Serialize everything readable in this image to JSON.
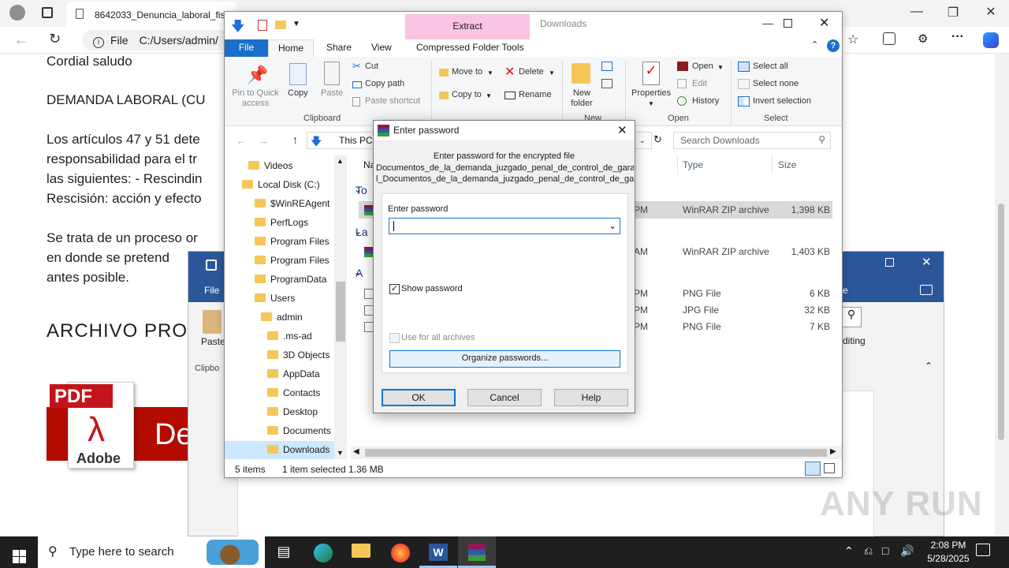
{
  "browser": {
    "tab_title": "8642033_Denuncia_laboral_fisc",
    "address_prefix": "File",
    "address": "C:/Users/admin/"
  },
  "document": {
    "lines": [
      "Cordial saludo",
      "DEMANDA LABORAL (CU",
      "Los artículos 47 y 51 dete",
      "responsabilidad para el tr",
      "las siguientes: - Rescindin",
      "Rescisión: acción y efecto",
      "Se trata de un proceso or",
      "en donde se pretend",
      "antes posible.",
      "ARCHIVO PRO"
    ],
    "pdf_label": "PDF",
    "adobe_label": "Adobe",
    "banner_text": "De"
  },
  "explorer": {
    "title": "Downloads",
    "context_tab_header": "Extract",
    "tabs": [
      "File",
      "Home",
      "Share",
      "View",
      "Compressed Folder Tools"
    ],
    "clipboard": {
      "pin": "Pin to Quick access",
      "copy": "Copy",
      "paste": "Paste",
      "cut": "Cut",
      "copy_path": "Copy path",
      "paste_shortcut": "Paste shortcut",
      "group": "Clipboard"
    },
    "organize": {
      "move_to": "Move to",
      "copy_to": "Copy to",
      "delete": "Delete",
      "rename": "Rename",
      "group": "Organize"
    },
    "new": {
      "new_folder": "New folder",
      "group": "New"
    },
    "open": {
      "properties": "Properties",
      "open": "Open",
      "edit": "Edit",
      "history": "History",
      "group": "Open"
    },
    "select": {
      "select_all": "Select all",
      "select_none": "Select none",
      "invert": "Invert selection",
      "group": "Select"
    },
    "breadcrumb": "This PC",
    "search_placeholder": "Search Downloads",
    "nav": [
      {
        "label": "Videos",
        "indent": 1
      },
      {
        "label": "Local Disk (C:)",
        "indent": 0
      },
      {
        "label": "$WinREAgent",
        "indent": 2
      },
      {
        "label": "PerfLogs",
        "indent": 2
      },
      {
        "label": "Program Files",
        "indent": 2
      },
      {
        "label": "Program Files",
        "indent": 2
      },
      {
        "label": "ProgramData",
        "indent": 2
      },
      {
        "label": "Users",
        "indent": 2
      },
      {
        "label": "admin",
        "indent": 3
      },
      {
        "label": ".ms-ad",
        "indent": 4
      },
      {
        "label": "3D Objects",
        "indent": 4
      },
      {
        "label": "AppData",
        "indent": 4
      },
      {
        "label": "Contacts",
        "indent": 4
      },
      {
        "label": "Desktop",
        "indent": 4
      },
      {
        "label": "Documents",
        "indent": 4
      },
      {
        "label": "Downloads",
        "indent": 4
      }
    ],
    "columns": {
      "name": "Na",
      "type": "Type",
      "size": "Size"
    },
    "groups": [
      "To",
      "La",
      "A"
    ],
    "rows": [
      {
        "time": "PM",
        "type": "WinRAR ZIP archive",
        "size": "1,398 KB"
      },
      {
        "time": "AM",
        "type": "WinRAR ZIP archive",
        "size": "1,403 KB"
      },
      {
        "time": "PM",
        "type": "PNG File",
        "size": "6 KB"
      },
      {
        "time": "PM",
        "type": "JPG File",
        "size": "32 KB"
      },
      {
        "time": "PM",
        "type": "PNG File",
        "size": "7 KB"
      }
    ],
    "status": {
      "items": "5 items",
      "selected": "1 item selected",
      "size": "1.36 MB"
    }
  },
  "dialog": {
    "title": "Enter password",
    "message": "Enter password for the encrypted file",
    "file_line1": "Documentos_de_la_demanda_juzgado_penal_de_control_de_garan",
    "file_line2": "l_Documentos_de_la_demanda_juzgado_penal_de_control_de_gara",
    "password_label": "Enter password",
    "password_value": "",
    "show_password": "Show password",
    "use_for_all": "Use for all archives",
    "organize": "Organize passwords...",
    "ok": "OK",
    "cancel": "Cancel",
    "help": "Help"
  },
  "word": {
    "file_tab": "File",
    "paste": "Paste",
    "clipboard": "Clipbo",
    "editing": "diting",
    "tab_fragment": "e"
  },
  "taskbar": {
    "search_placeholder": "Type here to search",
    "time": "2:08 PM",
    "date": "5/28/2025"
  },
  "watermark": "ANY RUN"
}
